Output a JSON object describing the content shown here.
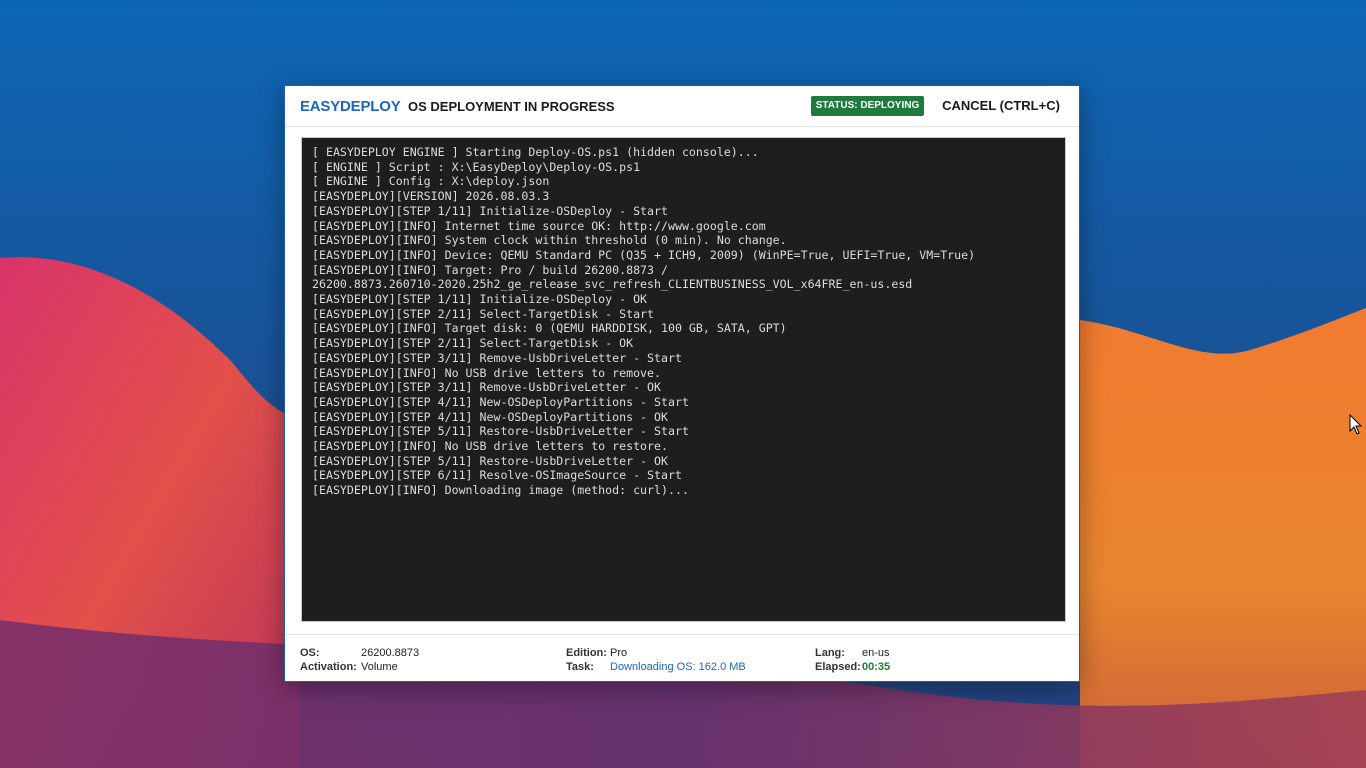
{
  "colors": {
    "accent": "#1a66b8",
    "status_green": "#1f7a3d",
    "console_bg": "#1e1e1e",
    "console_text": "#dcdcdc"
  },
  "header": {
    "brand": "EASYDEPLOY",
    "subtitle": "OS DEPLOYMENT IN PROGRESS",
    "status_badge": "STATUS: DEPLOYING",
    "cancel_label": "CANCEL (CTRL+C)"
  },
  "console": {
    "lines": [
      "[ EASYDEPLOY ENGINE ] Starting Deploy-OS.ps1 (hidden console)...",
      "[ ENGINE ] Script : X:\\EasyDeploy\\Deploy-OS.ps1",
      "[ ENGINE ] Config : X:\\deploy.json",
      "[EASYDEPLOY][VERSION] 2026.08.03.3",
      "[EASYDEPLOY][STEP 1/11] Initialize-OSDeploy - Start",
      "[EASYDEPLOY][INFO] Internet time source OK: http://www.google.com",
      "[EASYDEPLOY][INFO] System clock within threshold (0 min). No change.",
      "[EASYDEPLOY][INFO] Device: QEMU Standard PC (Q35 + ICH9, 2009) (WinPE=True, UEFI=True, VM=True)",
      "[EASYDEPLOY][INFO] Target: Pro / build 26200.8873 /",
      "26200.8873.260710-2020.25h2_ge_release_svc_refresh_CLIENTBUSINESS_VOL_x64FRE_en-us.esd",
      "[EASYDEPLOY][STEP 1/11] Initialize-OSDeploy - OK",
      "[EASYDEPLOY][STEP 2/11] Select-TargetDisk - Start",
      "[EASYDEPLOY][INFO] Target disk: 0 (QEMU HARDDISK, 100 GB, SATA, GPT)",
      "[EASYDEPLOY][STEP 2/11] Select-TargetDisk - OK",
      "[EASYDEPLOY][STEP 3/11] Remove-UsbDriveLetter - Start",
      "[EASYDEPLOY][INFO] No USB drive letters to remove.",
      "[EASYDEPLOY][STEP 3/11] Remove-UsbDriveLetter - OK",
      "[EASYDEPLOY][STEP 4/11] New-OSDeployPartitions - Start",
      "[EASYDEPLOY][STEP 4/11] New-OSDeployPartitions - OK",
      "[EASYDEPLOY][STEP 5/11] Restore-UsbDriveLetter - Start",
      "[EASYDEPLOY][INFO] No USB drive letters to restore.",
      "[EASYDEPLOY][STEP 5/11] Restore-UsbDriveLetter - OK",
      "[EASYDEPLOY][STEP 6/11] Resolve-OSImageSource - Start",
      "[EASYDEPLOY][INFO] Downloading image (method: curl)..."
    ]
  },
  "footer": {
    "os_label": "OS:",
    "os_value": "26200.8873",
    "activation_label": "Activation:",
    "activation_value": "Volume",
    "edition_label": "Edition:",
    "edition_value": "Pro",
    "task_label": "Task:",
    "task_value": "Downloading OS: 162.0 MB",
    "lang_label": "Lang:",
    "lang_value": "en-us",
    "elapsed_label": "Elapsed:",
    "elapsed_value": "00:35"
  },
  "icons": {
    "cursor": "mouse-pointer-icon"
  }
}
